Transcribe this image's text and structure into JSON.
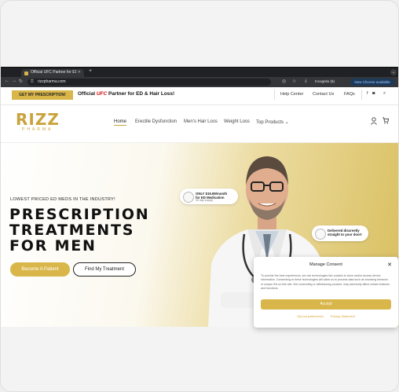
{
  "browser": {
    "tab_title": "Official UFC Partner for ED & ...",
    "url": "rizzpharma.com",
    "incognito": "Incognito (6)",
    "chrome_available": "New Chrome available"
  },
  "topbar": {
    "cta": "GET MY PRESCRIPTION!",
    "tagline_pre": "Official",
    "tagline_brand": "UFC",
    "tagline_post": "Partner for ED & Hair Loss!",
    "links": [
      "Help Center",
      "Contact Us",
      "FAQs"
    ]
  },
  "logo": {
    "name": "RIZZ",
    "sub": "PHARMA"
  },
  "nav": {
    "items": [
      "Home",
      "Erectile Dysfunction",
      "Men's Hair Loss",
      "Weight Loss",
      "Top Products"
    ]
  },
  "hero": {
    "eyebrow": "LOWEST PRICED ED MEDS IN THE INDUSTRY!",
    "headline": [
      "PRESCRIPTION",
      "TREATMENTS",
      "FOR MEN"
    ],
    "primary_button": "Become A Patient",
    "secondary_button": "Find My Treatment",
    "pill1_title": "ONLY $19.99/month\nfor ED Medication",
    "pill1_sub": "30 day supply",
    "pill2_title": "Delivered discreetly\nstraight to your door!"
  },
  "consent": {
    "title": "Manage Consent",
    "body": "To provide the best experiences, we use technologies like cookies to store and/or access device information. Consenting to these technologies will allow us to process data such as browsing behavior or unique IDs on this site. Not consenting or withdrawing consent, may adversely affect certain features and functions.",
    "accept": "Accept",
    "links": [
      "Opt-out preferences",
      "Privacy Statement"
    ]
  },
  "colors": {
    "accent": "#d9b64a",
    "ufc": "#d20a0a"
  }
}
